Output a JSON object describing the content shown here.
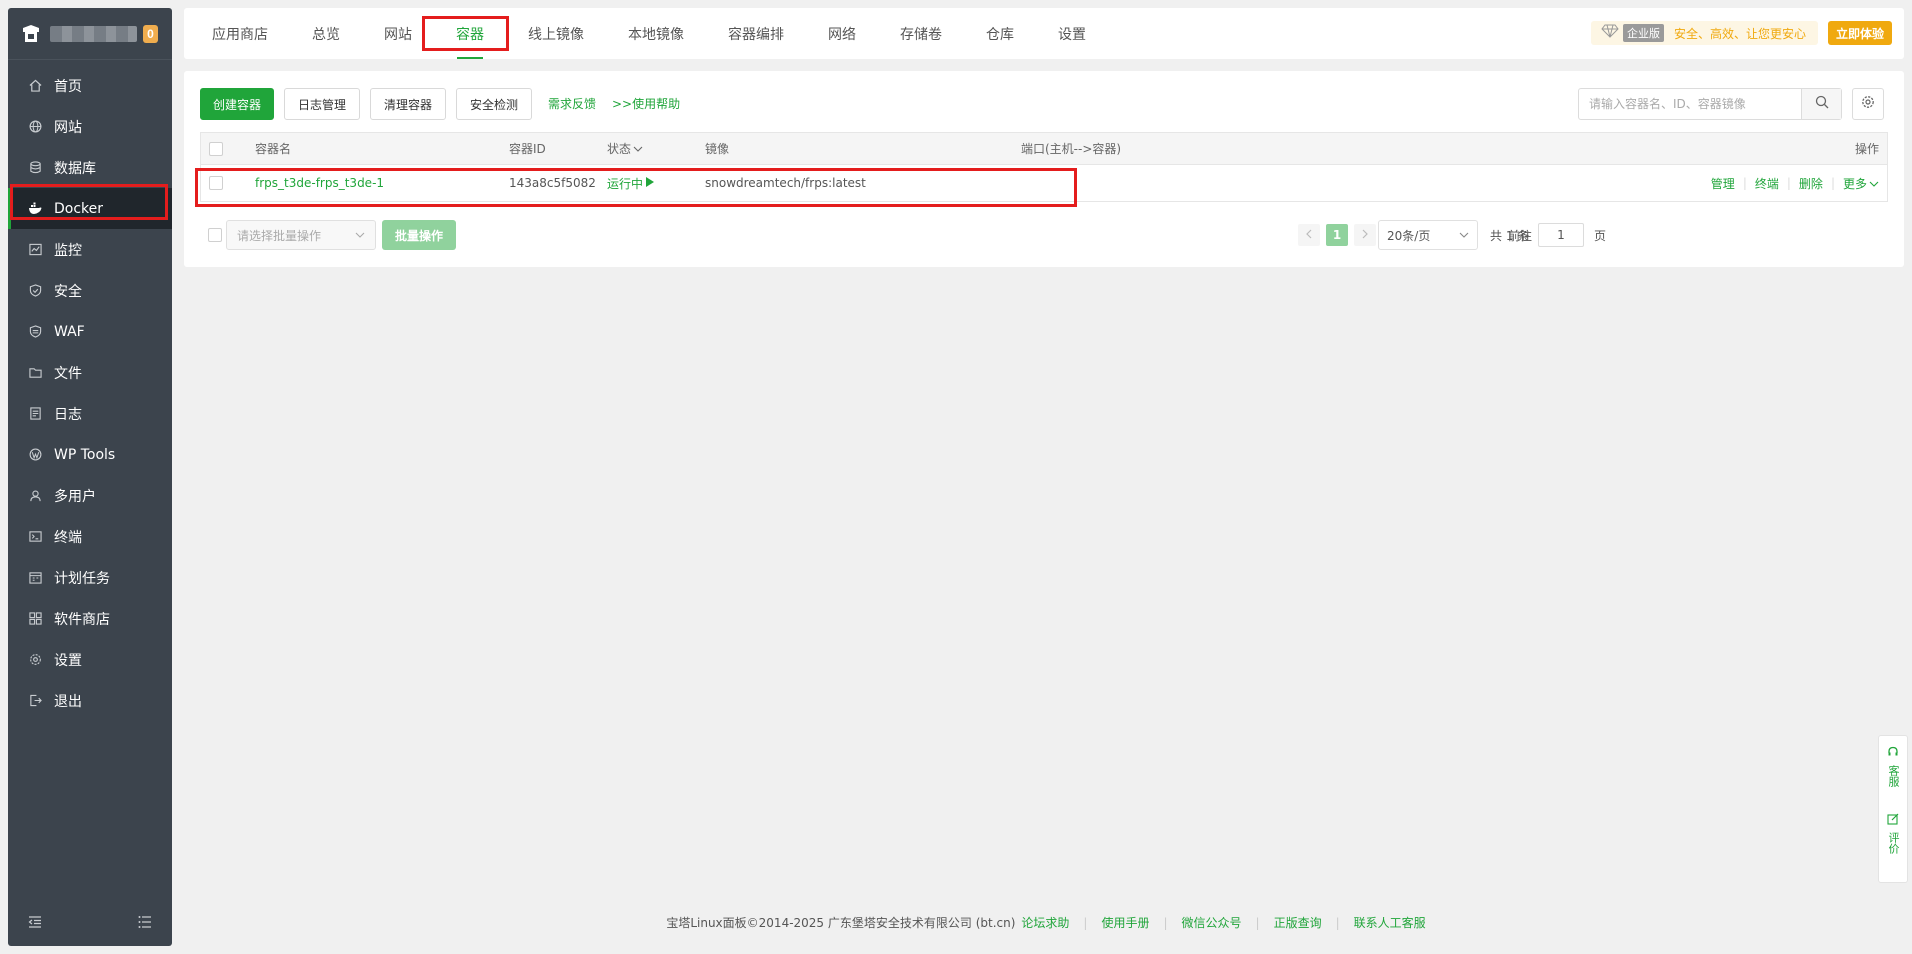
{
  "sidebar": {
    "badge": "0",
    "items": [
      {
        "label": "首页",
        "icon": "home-icon"
      },
      {
        "label": "网站",
        "icon": "globe-icon"
      },
      {
        "label": "数据库",
        "icon": "database-icon"
      },
      {
        "label": "Docker",
        "icon": "docker-icon"
      },
      {
        "label": "监控",
        "icon": "monitor-icon"
      },
      {
        "label": "安全",
        "icon": "shield-icon"
      },
      {
        "label": "WAF",
        "icon": "waf-icon"
      },
      {
        "label": "文件",
        "icon": "folder-icon"
      },
      {
        "label": "日志",
        "icon": "log-icon"
      },
      {
        "label": "WP Tools",
        "icon": "wordpress-icon"
      },
      {
        "label": "多用户",
        "icon": "users-icon"
      },
      {
        "label": "终端",
        "icon": "terminal-icon"
      },
      {
        "label": "计划任务",
        "icon": "calendar-icon"
      },
      {
        "label": "软件商店",
        "icon": "apps-icon"
      },
      {
        "label": "设置",
        "icon": "gear-icon"
      },
      {
        "label": "退出",
        "icon": "logout-icon"
      }
    ],
    "active": "Docker"
  },
  "tabs": [
    "应用商店",
    "总览",
    "网站",
    "容器",
    "线上镜像",
    "本地镜像",
    "容器编排",
    "网络",
    "存储卷",
    "仓库",
    "设置"
  ],
  "active_tab": "容器",
  "enterprise": {
    "tag": "企业版",
    "text": "安全、高效、让您更安心",
    "button": "立即体验"
  },
  "toolbar": {
    "create": "创建容器",
    "logs": "日志管理",
    "clean": "清理容器",
    "security": "安全检测",
    "feedback": "需求反馈",
    "help": ">>使用帮助",
    "search_placeholder": "请输入容器名、ID、容器镜像"
  },
  "table": {
    "headers": {
      "name": "容器名",
      "id": "容器ID",
      "status": "状态",
      "image": "镜像",
      "ports": "端口(主机-->容器)",
      "actions": "操作"
    },
    "rows": [
      {
        "name": "frps_t3de-frps_t3de-1",
        "id": "143a8c5f5082",
        "status": "运行中",
        "image": "snowdreamtech/frps:latest",
        "ports": "",
        "actions": [
          "管理",
          "终端",
          "删除",
          "更多"
        ]
      }
    ]
  },
  "pagination": {
    "batch_placeholder": "请选择批量操作",
    "batch_button": "批量操作",
    "current_page": "1",
    "per_page": "20条/页",
    "total": "共 1 条",
    "goto_label": "前往",
    "goto_value": "1",
    "page_suffix": "页"
  },
  "footer": {
    "copyright": "宝塔Linux面板©2014-2025 广东堡塔安全技术有限公司 (bt.cn)",
    "links": [
      "论坛求助",
      "使用手册",
      "微信公众号",
      "正版查询",
      "联系人工客服"
    ]
  },
  "float": {
    "service": "客服",
    "review": "评价"
  },
  "colors": {
    "accent": "#20a53a",
    "sidebar_bg": "#3c444d",
    "highlight": "#e41d1d",
    "enterprise": "#f0a90f"
  }
}
